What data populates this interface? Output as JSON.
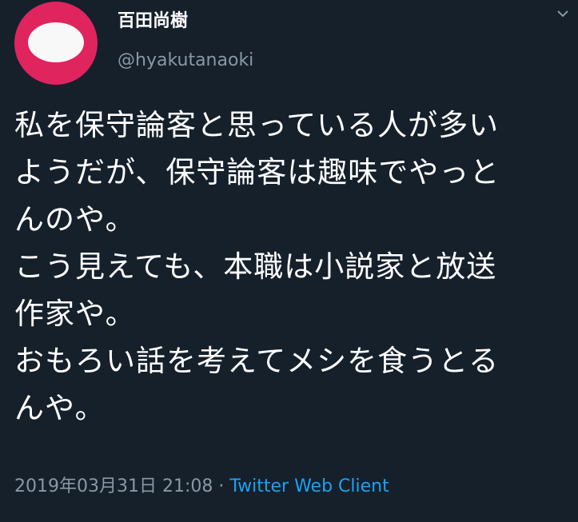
{
  "tweet": {
    "display_name": "百田尚樹",
    "username": "@hyakutanaoki",
    "body_lines": [
      "私を保守論客と思っている人が多い",
      "ようだが、保守論客は趣味でやっと",
      "んのや。",
      "こう見えても、本職は小説家と放送",
      "作家や。",
      "おもろい話を考えてメシを食うとる",
      "んや。"
    ],
    "timestamp": "2019年03月31日 21:08",
    "separator": " · ",
    "source": "Twitter Web Client"
  },
  "colors": {
    "background": "#15202b",
    "avatar": "#e0245e",
    "secondary_text": "#8899a6",
    "link": "#1da1f2"
  },
  "icons": {
    "more": "chevron-down-icon"
  }
}
